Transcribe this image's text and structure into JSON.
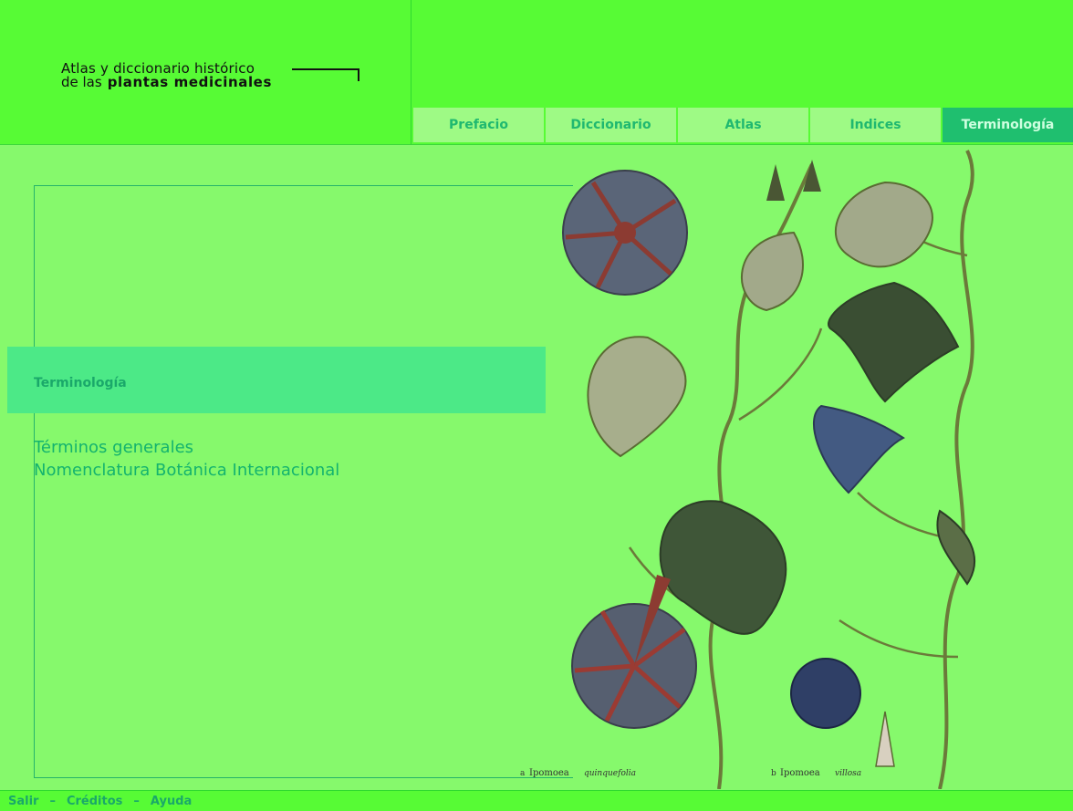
{
  "logo": {
    "line1": "Atlas y diccionario histórico",
    "line2a": "de  las",
    "line2b": "plantas medicinales"
  },
  "nav": {
    "tabs": [
      {
        "label": "Prefacio"
      },
      {
        "label": "Diccionario"
      },
      {
        "label": "Atlas"
      },
      {
        "label": "Indices"
      },
      {
        "label": "Terminología"
      }
    ]
  },
  "section": {
    "title": "Terminología",
    "links": [
      "Términos generales",
      "Nomenclatura Botánica Internacional"
    ]
  },
  "illustration": {
    "caption_left": "Ipomoea",
    "caption_right": "Ipomoea",
    "caption_left_prefix": "a",
    "caption_right_prefix": "b",
    "caption_left_species": "quinquefolia",
    "caption_right_species": "villosa"
  },
  "footer": {
    "salir": "Salir",
    "creditos": "Créditos",
    "ayuda": "Ayuda",
    "separator": "–"
  },
  "colors": {
    "background": "#86f96c",
    "header": "#57fb35",
    "tab": "#9efa85",
    "active_tab": "#1fbf6f",
    "accent_text": "#1aa86a",
    "band": "#4ce987"
  }
}
